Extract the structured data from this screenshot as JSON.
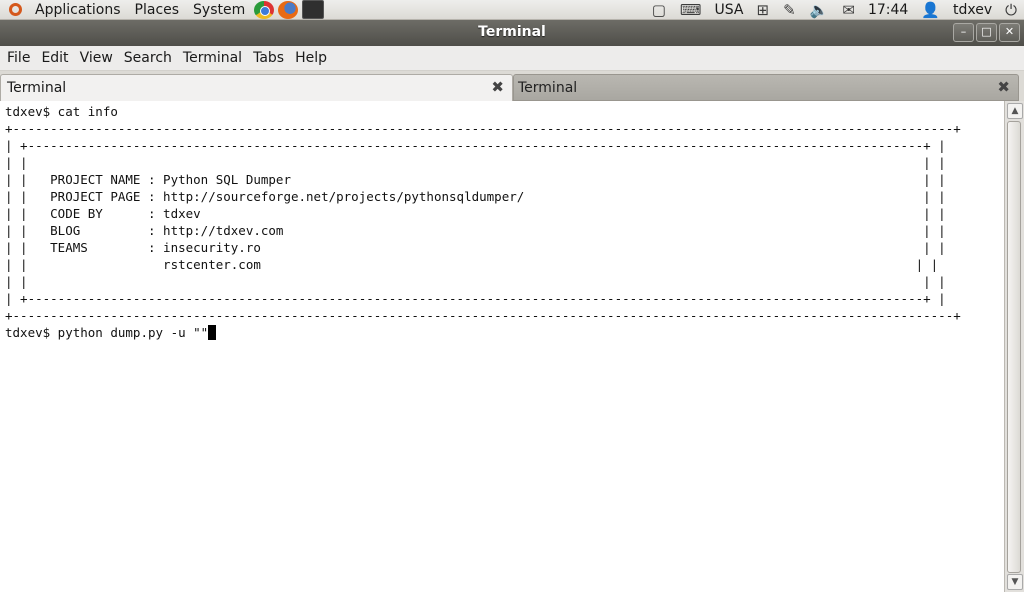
{
  "panel": {
    "menus": [
      "Applications",
      "Places",
      "System"
    ],
    "keyboard_layout": "USA",
    "clock": "17:44",
    "user": "tdxev",
    "tray_icons": [
      "window-icon",
      "keyboard-icon",
      "network-icon",
      "pen-icon",
      "volume-icon",
      "mail-icon",
      "user-icon",
      "power-icon"
    ]
  },
  "window": {
    "title": "Terminal"
  },
  "menubar": {
    "items": [
      "File",
      "Edit",
      "View",
      "Search",
      "Terminal",
      "Tabs",
      "Help"
    ]
  },
  "tabs": [
    {
      "label": "Terminal",
      "active": true
    },
    {
      "label": "Terminal",
      "active": false
    }
  ],
  "terminal": {
    "lines": [
      "tdxev$ cat info",
      "+-----------------------------------------------------------------------------------------------------------------------------+",
      "| +-----------------------------------------------------------------------------------------------------------------------+ |",
      "| |                                                                                                                       | |",
      "| |   PROJECT NAME : Python SQL Dumper                                                                                    | |",
      "| |   PROJECT PAGE : http://sourceforge.net/projects/pythonsqldumper/                                                     | |",
      "| |   CODE BY      : tdxev                                                                                                | |",
      "| |   BLOG         : http://tdxev.com                                                                                     | |",
      "| |   TEAMS        : insecurity.ro                                                                                        | |",
      "| |                  rstcenter.com                                                                                       | |",
      "| |                                                                                                                       | |",
      "| +-----------------------------------------------------------------------------------------------------------------------+ |",
      "+-----------------------------------------------------------------------------------------------------------------------------+"
    ],
    "prompt_line": "tdxev$ python dump.py -u \"\""
  }
}
